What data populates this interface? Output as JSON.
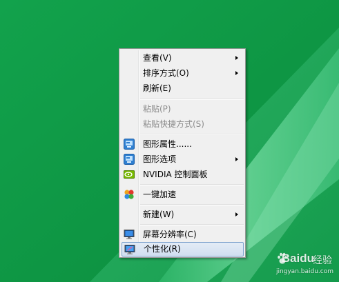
{
  "colors": {
    "desktop_background": "#0e9b45",
    "menu_background": "#f0f0f0",
    "menu_highlight_border": "#7da2ce",
    "disabled_text": "#8d8d8d"
  },
  "context_menu": {
    "items": [
      {
        "label": "查看(V)",
        "icon": null,
        "submenu": true,
        "enabled": true
      },
      {
        "label": "排序方式(O)",
        "icon": null,
        "submenu": true,
        "enabled": true
      },
      {
        "label": "刷新(E)",
        "icon": null,
        "submenu": false,
        "enabled": true
      },
      {
        "label": "粘贴(P)",
        "icon": null,
        "submenu": false,
        "enabled": false
      },
      {
        "label": "粘贴快捷方式(S)",
        "icon": null,
        "submenu": false,
        "enabled": false
      },
      {
        "label": "图形属性......",
        "icon": "intel-graphics-icon",
        "submenu": false,
        "enabled": true
      },
      {
        "label": "图形选项",
        "icon": "intel-graphics-icon",
        "submenu": true,
        "enabled": true
      },
      {
        "label": "NVIDIA 控制面板",
        "icon": "nvidia-icon",
        "submenu": false,
        "enabled": true
      },
      {
        "label": "一键加速",
        "icon": "speedup-icon",
        "submenu": false,
        "enabled": true
      },
      {
        "label": "新建(W)",
        "icon": null,
        "submenu": true,
        "enabled": true
      },
      {
        "label": "屏幕分辨率(C)",
        "icon": "screen-resolution-icon",
        "submenu": false,
        "enabled": true
      },
      {
        "label": "个性化(R)",
        "icon": "personalize-icon",
        "submenu": false,
        "enabled": true,
        "highlighted": true
      }
    ]
  },
  "watermark": {
    "brand": "Baidu",
    "suffix": "经验",
    "url": "jingyan.baidu.com"
  }
}
